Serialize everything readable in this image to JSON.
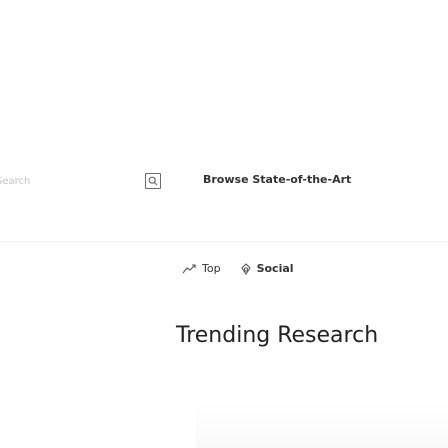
{
  "search": {
    "placeholder": "Search"
  },
  "nav": {
    "browse_label": "Browse State-of-the-Art"
  },
  "tabs": [
    {
      "label": "Top",
      "icon": "trend-icon"
    },
    {
      "label": "Social",
      "icon": "social-icon"
    }
  ],
  "section": {
    "title": "Trending Research"
  },
  "colors": {
    "text": "#333333",
    "placeholder": "#c4c4c4",
    "icon_border": "#6b6b6b"
  }
}
